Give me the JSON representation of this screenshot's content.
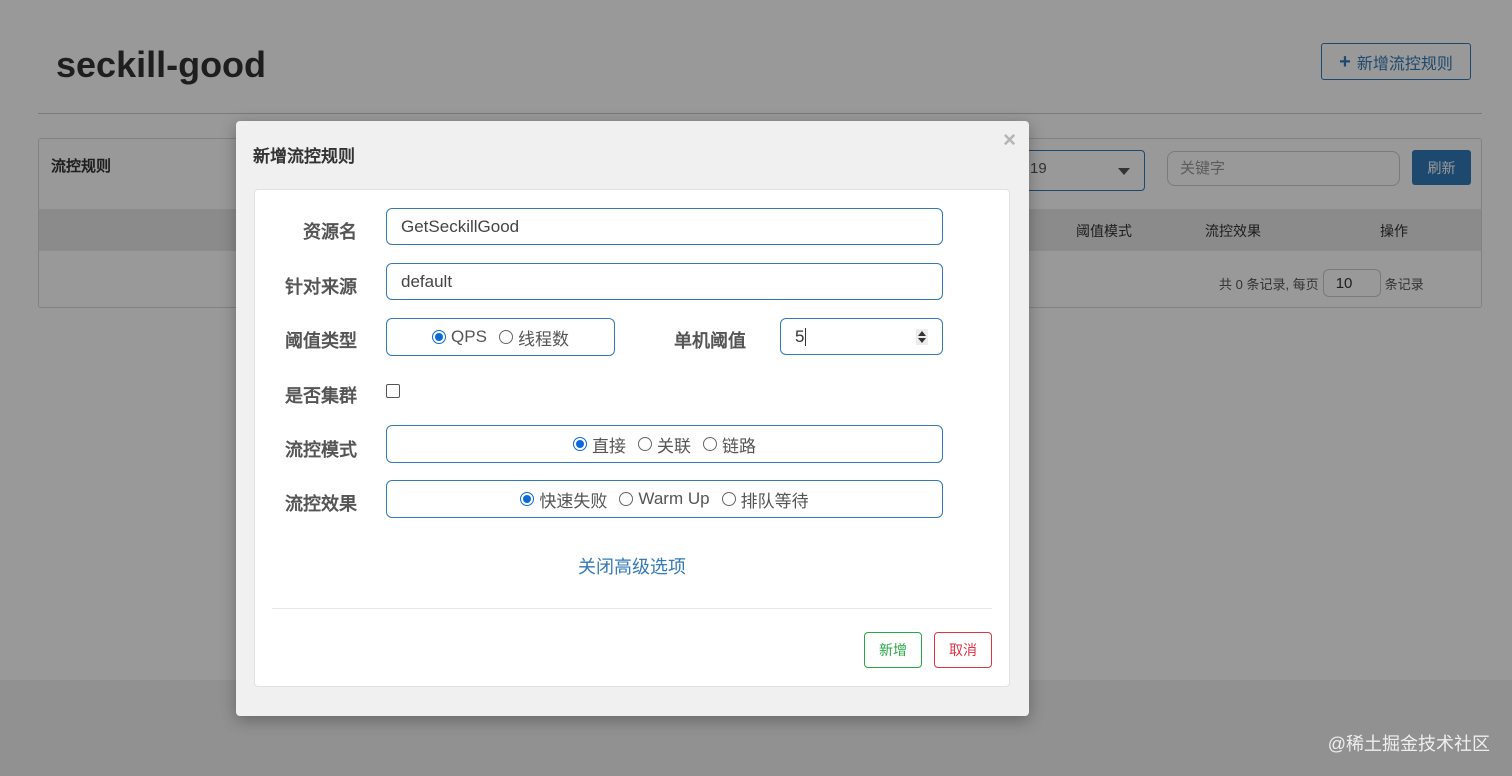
{
  "page": {
    "title": "seckill-good",
    "add_rule_button": "新增流控规则"
  },
  "panel": {
    "title": "流控规则",
    "machine_select_value": "19",
    "keyword_placeholder": "关键字",
    "refresh_button": "刷新",
    "columns": [
      "阈值模式",
      "流控效果",
      "操作"
    ],
    "pager": {
      "total_text": "共 0 条记录, 每页",
      "page_size": "10",
      "suffix": "条记录"
    }
  },
  "dialog": {
    "title": "新增流控规则",
    "close_symbol": "×",
    "fields": {
      "resource_label": "资源名",
      "resource_value": "GetSeckillGood",
      "origin_label": "针对来源",
      "origin_value": "default",
      "grade_label": "阈值类型",
      "grade_options": [
        {
          "label": "QPS",
          "checked": true
        },
        {
          "label": "线程数",
          "checked": false
        }
      ],
      "threshold_label": "单机阈值",
      "threshold_value": "5",
      "cluster_label": "是否集群",
      "cluster_checked": false,
      "strategy_label": "流控模式",
      "strategy_options": [
        {
          "label": "直接",
          "checked": true
        },
        {
          "label": "关联",
          "checked": false
        },
        {
          "label": "链路",
          "checked": false
        }
      ],
      "effect_label": "流控效果",
      "effect_options": [
        {
          "label": "快速失败",
          "checked": true
        },
        {
          "label": "Warm Up",
          "checked": false
        },
        {
          "label": "排队等待",
          "checked": false
        }
      ]
    },
    "advanced_link": "关闭高级选项",
    "add_button": "新增",
    "cancel_button": "取消"
  },
  "watermark": "@稀土掘金技术社区",
  "colors": {
    "primary": "#337ab7",
    "radio_checked": "#0b6ad8",
    "add_green": "#28a745",
    "cancel_red": "#dc3545"
  }
}
